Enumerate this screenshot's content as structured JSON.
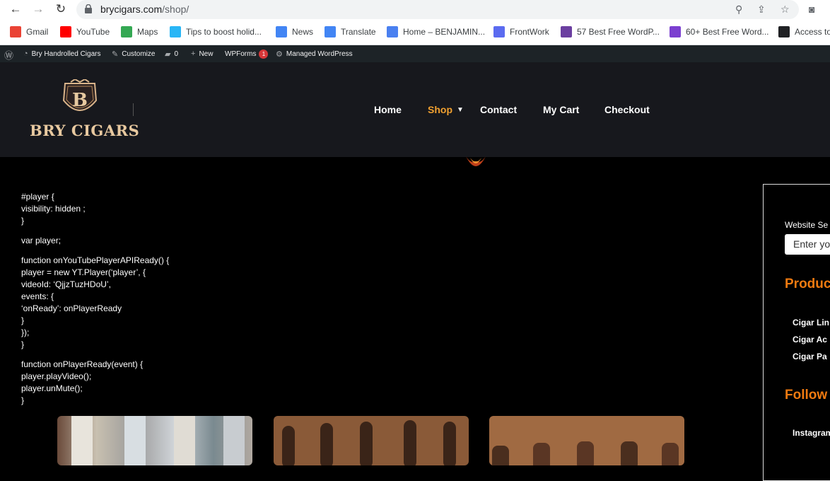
{
  "browser": {
    "url_domain": "brycigars.com",
    "url_path": "/shop/"
  },
  "bookmarks": [
    {
      "label": "Gmail",
      "icon": "gmail-icon",
      "color": "#ea4335"
    },
    {
      "label": "YouTube",
      "icon": "youtube-icon",
      "color": "#ff0000"
    },
    {
      "label": "Maps",
      "icon": "maps-icon",
      "color": "#34a853"
    },
    {
      "label": "Tips to boost holid...",
      "icon": "tips-icon",
      "color": "#29b6f6"
    },
    {
      "label": "News",
      "icon": "news-icon",
      "color": "#4285f4"
    },
    {
      "label": "Translate",
      "icon": "translate-icon",
      "color": "#4285f4"
    },
    {
      "label": "Home – BENJAMIN...",
      "icon": "home-icon",
      "color": "#4a80f0"
    },
    {
      "label": "FrontWork",
      "icon": "frontwork-icon",
      "color": "#5b6bf0"
    },
    {
      "label": "57 Best Free WordP...",
      "icon": "colorlib-icon",
      "color": "#6b3fa0"
    },
    {
      "label": "60+ Best Free Word...",
      "icon": "h-icon",
      "color": "#7b3fd0"
    },
    {
      "label": "Access to",
      "icon": "globe-icon",
      "color": "#202124"
    }
  ],
  "wpbar": {
    "site_name": "Bry Handrolled Cigars",
    "customize": "Customize",
    "comments": "0",
    "new": "New",
    "wpforms": "WPForms",
    "wpforms_count": "1",
    "managed": "Managed WordPress"
  },
  "site": {
    "logo_text": "BRY CIGARS",
    "logo_letter": "B",
    "menu": [
      "Home",
      "Shop",
      "Contact",
      "My Cart",
      "Checkout"
    ],
    "active_menu": "Shop",
    "accent": "#f0a030"
  },
  "code_lines": [
    "#player {",
    "visibility: hidden ;",
    "}",
    "",
    "var player;",
    "",
    "function onYouTubePlayerAPIReady() {",
    "player = new YT.Player(‘player’, {",
    "videoId: ‘QjjzTuzHDoU’,",
    "events: {",
    "‘onReady’: onPlayerReady",
    "}",
    "});",
    "}",
    "",
    "function onPlayerReady(event) {",
    "player.playVideo();",
    "player.unMute();",
    "}"
  ],
  "sidebar": {
    "search_label": "Website Se",
    "search_placeholder": "Enter yo",
    "products_heading": "Produc",
    "links": [
      "Cigar Lin",
      "Cigar Ac",
      "Cigar Pa"
    ],
    "follow_heading": "Follow u",
    "social": "Instagram"
  }
}
